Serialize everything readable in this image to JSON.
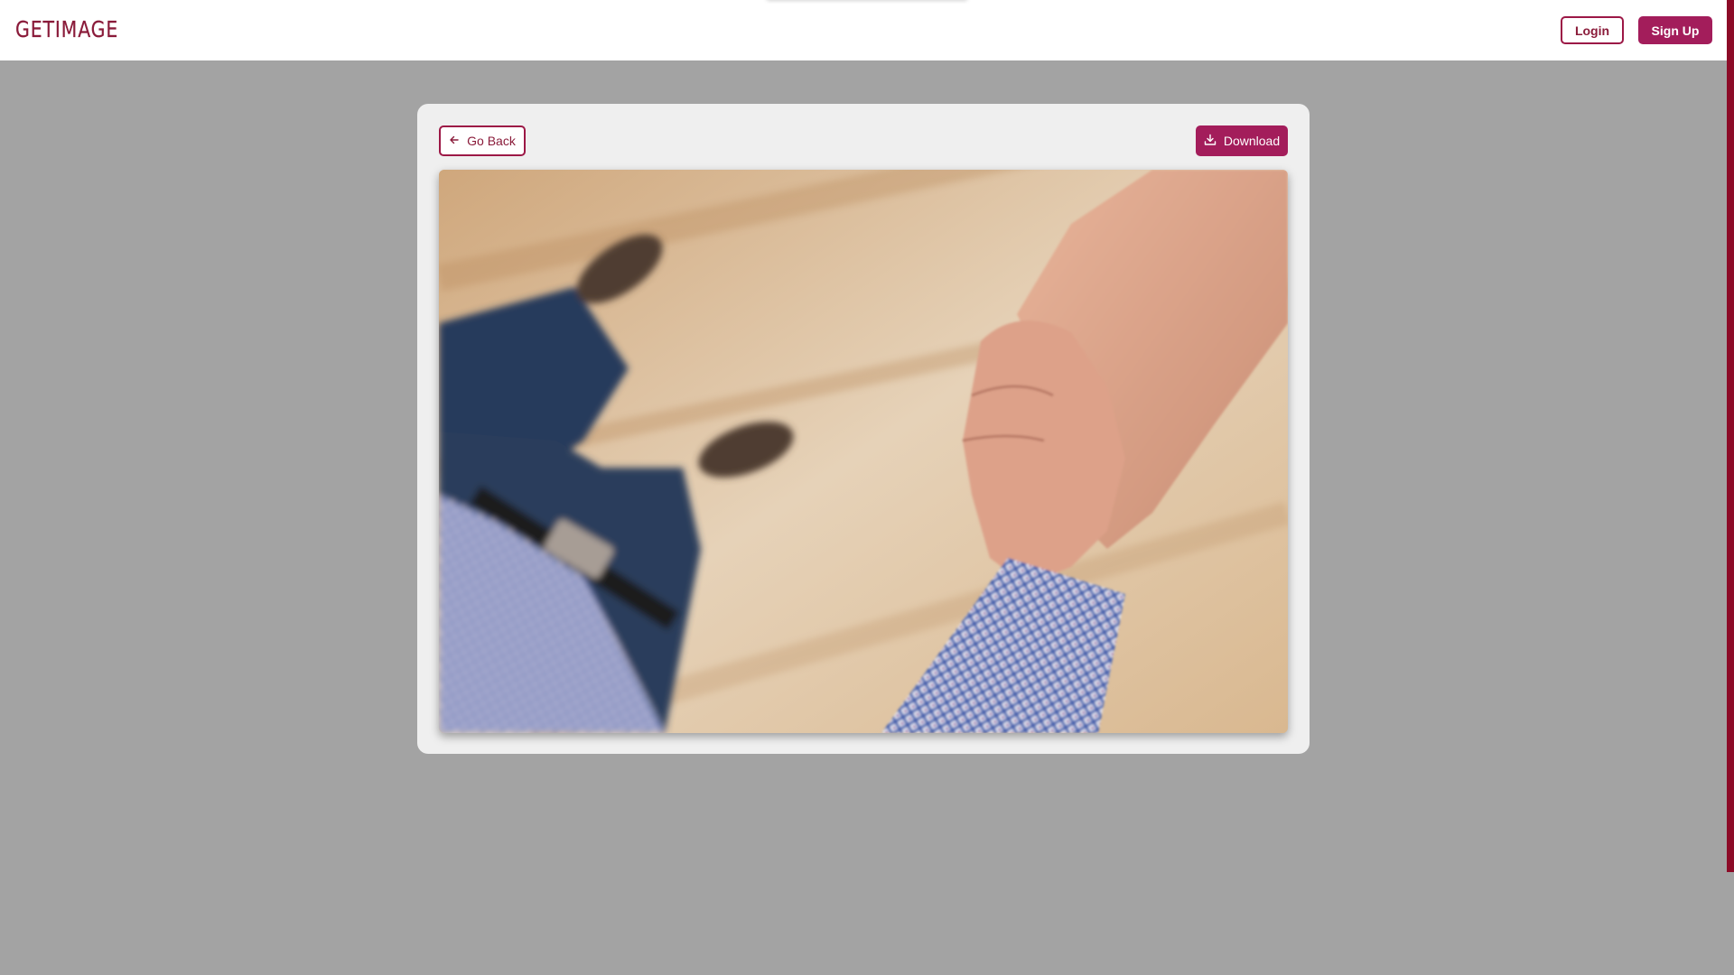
{
  "header": {
    "logo_text": "GETIMAGE",
    "login_label": "Login",
    "signup_label": "Sign Up"
  },
  "viewer": {
    "back_label": "Go Back",
    "download_label": "Download",
    "back_icon": "arrow-left-icon",
    "download_icon": "download-icon"
  },
  "colors": {
    "brand": "#8a1b3a",
    "accent": "#a31d5b",
    "page_background": "#a3a3a3",
    "card_background": "#efefef"
  }
}
